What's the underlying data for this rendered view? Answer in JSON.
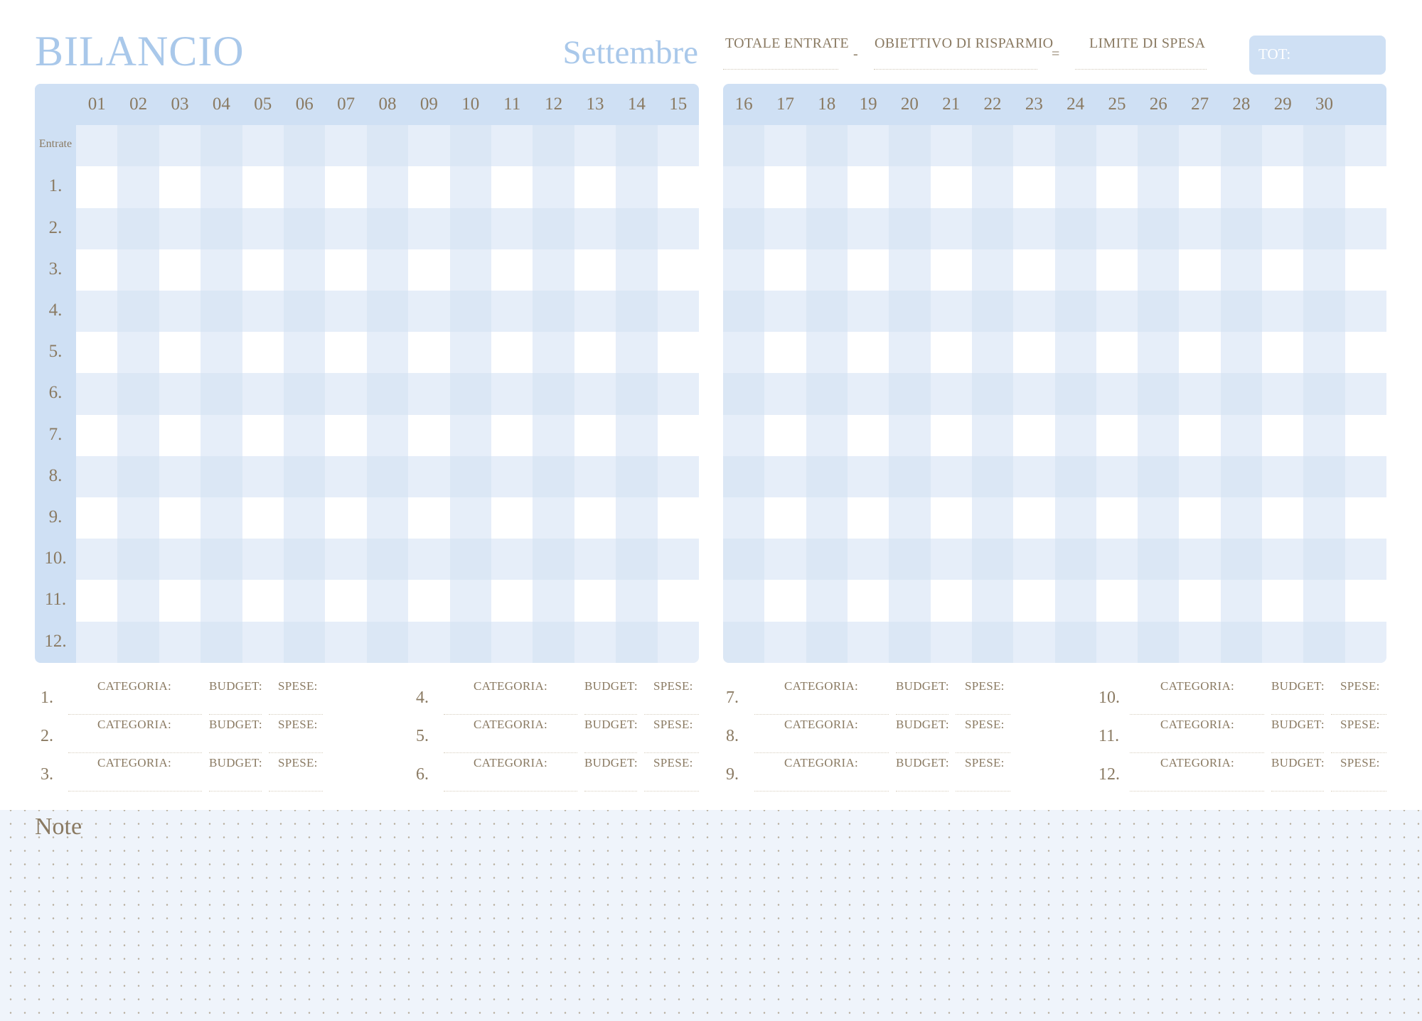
{
  "header": {
    "title": "BILANCIO",
    "month": "Settembre",
    "summary": {
      "income_label": "TOTALE ENTRATE",
      "minus": "-",
      "savings_label": "OBIETTIVO DI RISPARMIO",
      "equals": "=",
      "limit_label": "LIMITE DI SPESA",
      "total_label": "TOT:"
    }
  },
  "grid": {
    "days_left": [
      "01",
      "02",
      "03",
      "04",
      "05",
      "06",
      "07",
      "08",
      "09",
      "10",
      "11",
      "12",
      "13",
      "14",
      "15"
    ],
    "days_right": [
      "16",
      "17",
      "18",
      "19",
      "20",
      "21",
      "22",
      "23",
      "24",
      "25",
      "26",
      "27",
      "28",
      "29",
      "30"
    ],
    "income_row_label": "Entrate",
    "rows": [
      "1.",
      "2.",
      "3.",
      "4.",
      "5.",
      "6.",
      "7.",
      "8.",
      "9.",
      "10.",
      "11.",
      "12."
    ]
  },
  "categories": {
    "category_label": "CATEGORIA:",
    "budget_label": "BUDGET:",
    "spese_label": "SPESE:",
    "numbers": [
      "1.",
      "2.",
      "3.",
      "4.",
      "5.",
      "6.",
      "7.",
      "8.",
      "9.",
      "10.",
      "11.",
      "12."
    ]
  },
  "notes": {
    "title": "Note"
  },
  "colors": {
    "accent": "#a9c8ea",
    "header_band": "#cfe0f4",
    "check_light": "#e6eef9",
    "check_mid": "#dbe7f5",
    "text": "#8a7a62",
    "notes_bg": "#eff4fb"
  }
}
